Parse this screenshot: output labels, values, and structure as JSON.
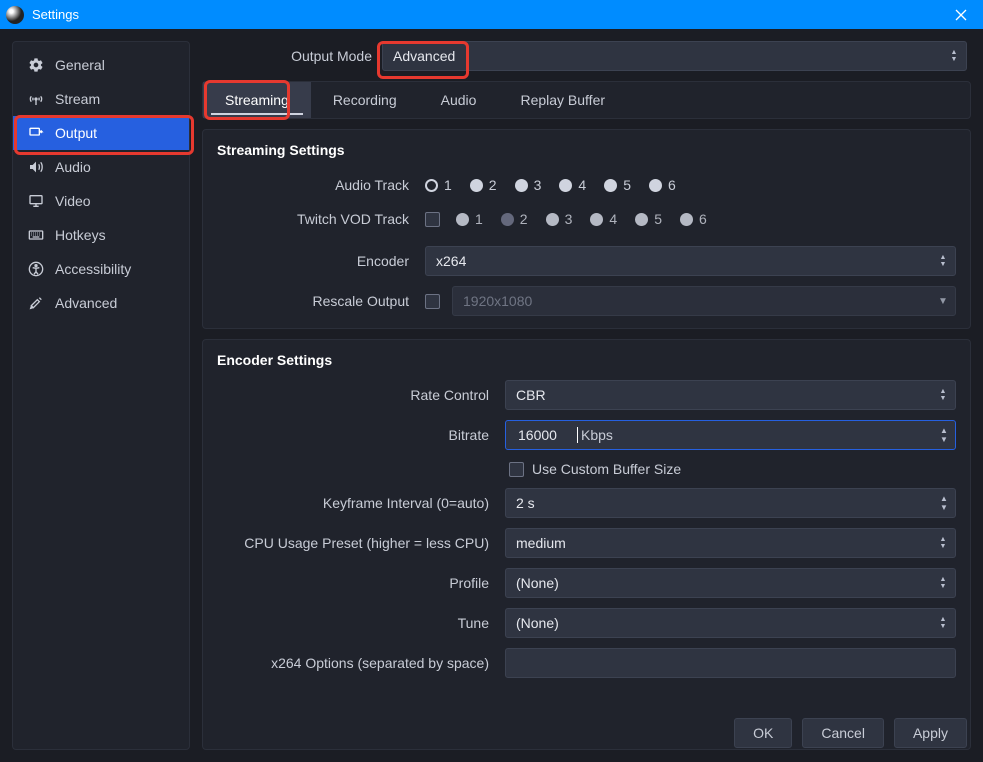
{
  "window": {
    "title": "Settings"
  },
  "sidebar": {
    "items": [
      {
        "name": "general",
        "label": "General"
      },
      {
        "name": "stream",
        "label": "Stream"
      },
      {
        "name": "output",
        "label": "Output",
        "selected": true
      },
      {
        "name": "audio",
        "label": "Audio"
      },
      {
        "name": "video",
        "label": "Video"
      },
      {
        "name": "hotkeys",
        "label": "Hotkeys"
      },
      {
        "name": "accessibility",
        "label": "Accessibility"
      },
      {
        "name": "advanced",
        "label": "Advanced"
      }
    ]
  },
  "output_mode": {
    "label": "Output Mode",
    "value": "Advanced"
  },
  "tabs": [
    "Streaming",
    "Recording",
    "Audio",
    "Replay Buffer"
  ],
  "streaming": {
    "heading": "Streaming Settings",
    "audio_track": {
      "label": "Audio Track",
      "options": [
        "1",
        "2",
        "3",
        "4",
        "5",
        "6"
      ],
      "selected": "1"
    },
    "vod_track": {
      "label": "Twitch VOD Track",
      "enabled": false,
      "options": [
        "1",
        "2",
        "3",
        "4",
        "5",
        "6"
      ],
      "selected": "2"
    },
    "encoder": {
      "label": "Encoder",
      "value": "x264"
    },
    "rescale": {
      "label": "Rescale Output",
      "enabled": false,
      "value": "1920x1080"
    }
  },
  "encoder": {
    "heading": "Encoder Settings",
    "rate_control": {
      "label": "Rate Control",
      "value": "CBR"
    },
    "bitrate": {
      "label": "Bitrate",
      "value": "16000",
      "unit": "Kbps"
    },
    "custom_buffer": {
      "label": "Use Custom Buffer Size",
      "enabled": false
    },
    "keyframe": {
      "label": "Keyframe Interval (0=auto)",
      "value": "2 s"
    },
    "cpu_preset": {
      "label": "CPU Usage Preset (higher = less CPU)",
      "value": "medium"
    },
    "profile": {
      "label": "Profile",
      "value": "(None)"
    },
    "tune": {
      "label": "Tune",
      "value": "(None)"
    },
    "x264_opts": {
      "label": "x264 Options (separated by space)",
      "value": ""
    }
  },
  "buttons": {
    "ok": "OK",
    "cancel": "Cancel",
    "apply": "Apply"
  },
  "colors": {
    "accent": "#2660e0",
    "titlebar": "#008cff",
    "highlight": "#e6392f"
  }
}
